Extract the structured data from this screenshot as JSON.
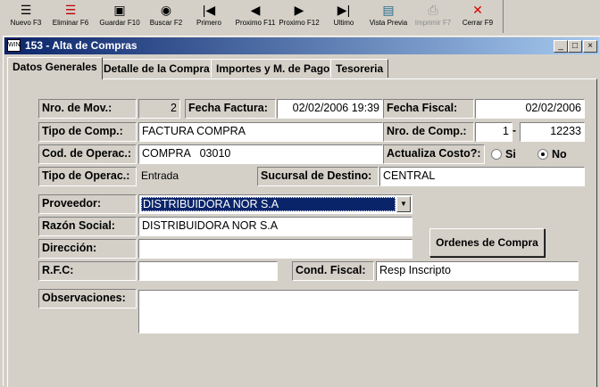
{
  "toolbar": {
    "buttons": [
      {
        "label": "Nuevo F3",
        "icon": "new-icon",
        "glyph": "☰"
      },
      {
        "label": "Eliminar F6",
        "icon": "delete-icon",
        "glyph": "☰"
      },
      {
        "label": "Guardar F10",
        "icon": "save-icon",
        "glyph": "▣"
      },
      {
        "label": "Buscar F2",
        "icon": "binoculars-icon",
        "glyph": "◉"
      },
      {
        "label": "Primero",
        "icon": "first-icon",
        "glyph": "|◀"
      },
      {
        "label": "Proximo F11",
        "icon": "previous-icon",
        "glyph": "◀"
      },
      {
        "label": "Proximo F12",
        "icon": "next-icon",
        "glyph": "▶"
      },
      {
        "label": "Ultimo",
        "icon": "last-icon",
        "glyph": "▶|"
      },
      {
        "label": "Vista Previa",
        "icon": "preview-icon",
        "glyph": "▤"
      },
      {
        "label": "Imprimir F7",
        "icon": "print-icon",
        "glyph": "⎙"
      },
      {
        "label": "Cerrar F9",
        "icon": "close-icon",
        "glyph": "✕"
      }
    ]
  },
  "window": {
    "title": "153 - Alta de Compras",
    "icon_text": "WIN",
    "controls": [
      "_",
      "□",
      "×"
    ]
  },
  "tabs": [
    "Datos Generales",
    "Detalle de la Compra",
    "Importes y M. de Pago",
    "Tesoreria"
  ],
  "form": {
    "nro_mov": {
      "label": "Nro. de Mov.:",
      "value": "2"
    },
    "fecha_factura": {
      "label": "Fecha Factura:",
      "value": "02/02/2006 19:39"
    },
    "fecha_fiscal": {
      "label": "Fecha Fiscal:",
      "value": "02/02/2006"
    },
    "tipo_comp": {
      "label": "Tipo de Comp.:",
      "value": "FACTURA COMPRA"
    },
    "nro_comp": {
      "label": "Nro. de Comp.:",
      "prefix": "1",
      "separator": "-",
      "number": "12233"
    },
    "cod_operac": {
      "label": "Cod. de Operac.:",
      "value": "COMPRA   03010"
    },
    "actualiza_costo": {
      "label": "Actualiza Costo?:",
      "option_si": "Si",
      "option_no": "No",
      "selected": "No"
    },
    "tipo_operac": {
      "label": "Tipo de Operac.:",
      "value": "Entrada"
    },
    "sucursal_destino": {
      "label": "Sucursal de Destino:",
      "value": "CENTRAL"
    },
    "proveedor": {
      "label": "Proveedor:",
      "value": "DISTRIBUIDORA NOR S.A"
    },
    "razon_social": {
      "label": "Razón Social:",
      "value": "DISTRIBUIDORA NOR S.A"
    },
    "direccion": {
      "label": "Dirección:",
      "value": ""
    },
    "rfc": {
      "label": "R.F.C:",
      "value": ""
    },
    "cond_fiscal": {
      "label": "Cond. Fiscal:",
      "value": "Resp Inscripto"
    },
    "observaciones": {
      "label": "Observaciones:",
      "value": ""
    },
    "ordenes_button": "Ordenes de Compra"
  }
}
